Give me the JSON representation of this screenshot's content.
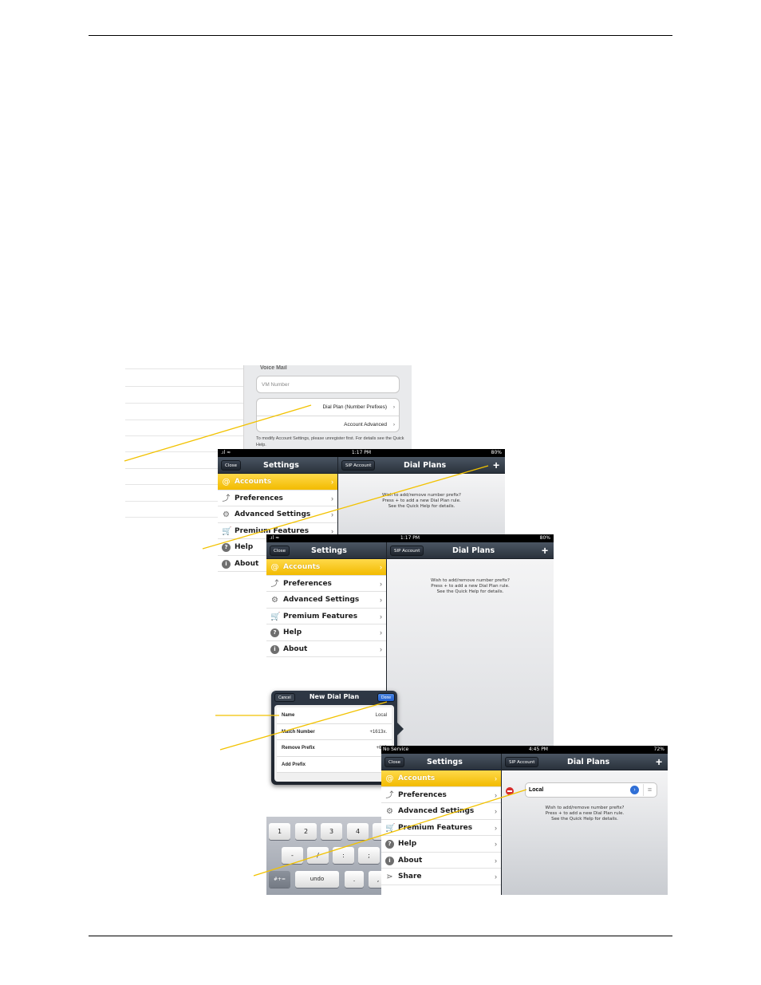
{
  "screen1": {
    "section_title": "Voice Mail",
    "vm_placeholder": "VM Number",
    "row_dial_plan": "Dial Plan (Number Prefixes)",
    "row_account_advanced": "Account Advanced",
    "note": "To modify Account Settings, please unregister first. For details see the Quick Help."
  },
  "screen2": {
    "status": {
      "time": "1:17 PM",
      "battery": "80%"
    },
    "nav": {
      "close": "Close",
      "settings_title": "Settings",
      "sip_account": "SIP Account",
      "dial_plans_title": "Dial Plans",
      "add": "+"
    },
    "menu": [
      "Accounts",
      "Preferences",
      "Advanced Settings",
      "Premium Features",
      "Help",
      "About"
    ],
    "help": [
      "Wish to add/remove number prefix?",
      "Press + to add a new Dial Plan rule.",
      "See the Quick Help for details."
    ]
  },
  "screen3": {
    "status": {
      "time": "1:17 PM",
      "battery": "80%"
    },
    "nav": {
      "close": "Close",
      "settings_title": "Settings",
      "sip_account": "SIP Account",
      "dial_plans_title": "Dial Plans",
      "add": "+"
    },
    "menu": [
      "Accounts",
      "Preferences",
      "Advanced Settings",
      "Premium Features",
      "Help",
      "About"
    ],
    "help": [
      "Wish to add/remove number prefix?",
      "Press + to add a new Dial Plan rule.",
      "See the Quick Help for details."
    ],
    "popover": {
      "title": "New Dial Plan",
      "cancel": "Cancel",
      "done": "Done",
      "rows": [
        {
          "label": "Name",
          "value": "Local"
        },
        {
          "label": "Match Number",
          "value": "+1613x."
        },
        {
          "label": "Remove Prefix",
          "value": "+613"
        },
        {
          "label": "Add Prefix",
          "value": "9"
        }
      ]
    },
    "keyboard": {
      "row1": [
        "1",
        "2",
        "3",
        "4"
      ],
      "row2": [
        "-",
        "/",
        ":",
        ";"
      ],
      "row3": [
        "#+=",
        "undo",
        ".",
        ","
      ]
    }
  },
  "screen4": {
    "status": {
      "carrier": "No Service",
      "time": "4:45 PM",
      "battery": "72%"
    },
    "nav": {
      "close": "Close",
      "settings_title": "Settings",
      "sip_account": "SIP Account",
      "dial_plans_title": "Dial Plans",
      "add": "+"
    },
    "menu": [
      "Accounts",
      "Preferences",
      "Advanced Settings",
      "Premium Features",
      "Help",
      "About",
      "Share"
    ],
    "rule_name": "Local",
    "help": [
      "Wish to add/remove number prefix?",
      "Press + to add a new Dial Plan rule.",
      "See the Quick Help for details."
    ]
  },
  "colors": {
    "callout": "#f2c200",
    "highlight": "#f7c600",
    "navbar": "#2f3844"
  },
  "icons": [
    "at-icon",
    "wrench-icon",
    "gears-icon",
    "cart-icon",
    "help-icon",
    "info-icon",
    "share-icon",
    "chevron-right-icon",
    "plus-icon",
    "detail-disclosure-icon",
    "reorder-icon",
    "delete-icon"
  ]
}
